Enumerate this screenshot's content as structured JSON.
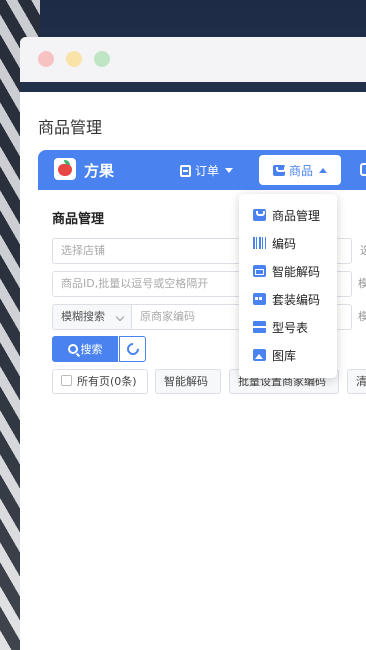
{
  "window": {
    "heading": "商品管理"
  },
  "topbar": {
    "brand": "方果",
    "nav_orders": "订单",
    "nav_goods": "商品"
  },
  "panel": {
    "title": "商品管理",
    "shop_placeholder": "选择店铺",
    "ids_placeholder": "商品ID,批量以逗号或空格隔开",
    "fuzzy_label": "模糊搜索",
    "code_placeholder": "原商家编码",
    "search_label": "搜索",
    "all_pages_label": "所有页(0条)",
    "smart_decode_label": "智能解码",
    "batch_set_label": "批量设置商家编码",
    "clear_label": "清",
    "stub_right_1": "选",
    "stub_right_2": "模",
    "stub_right_3": "模"
  },
  "dropdown": {
    "items": [
      "商品管理",
      "编码",
      "智能解码",
      "套装编码",
      "型号表",
      "图库"
    ]
  },
  "colors": {
    "accent": "#4a83f0"
  }
}
